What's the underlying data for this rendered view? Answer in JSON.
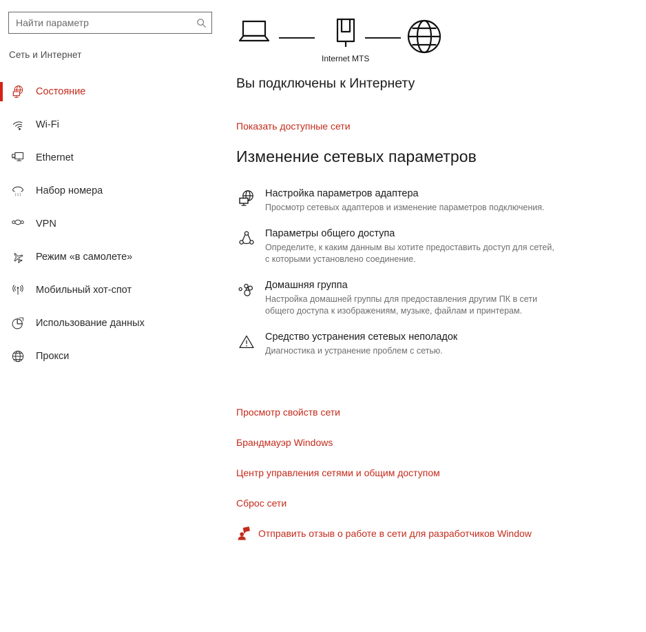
{
  "colors": {
    "accent": "#c42b1c",
    "accent_bar": "#d32216",
    "text_primary": "#1b1b1b",
    "text_secondary": "#6e6e6e",
    "background": "#ffffff"
  },
  "sidebar": {
    "search": {
      "placeholder": "Найти параметр",
      "value": "",
      "icon": "search-icon"
    },
    "category_title": "Сеть и Интернет",
    "items": [
      {
        "label": "Состояние",
        "icon": "network-status-icon",
        "selected": true
      },
      {
        "label": "Wi-Fi",
        "icon": "wifi-icon",
        "selected": false
      },
      {
        "label": "Ethernet",
        "icon": "ethernet-icon",
        "selected": false
      },
      {
        "label": "Набор номера",
        "icon": "dialup-icon",
        "selected": false
      },
      {
        "label": "VPN",
        "icon": "vpn-icon",
        "selected": false
      },
      {
        "label": "Режим «в самолете»",
        "icon": "airplane-icon",
        "selected": false
      },
      {
        "label": "Мобильный хот-спот",
        "icon": "hotspot-icon",
        "selected": false
      },
      {
        "label": "Использование данных",
        "icon": "data-usage-icon",
        "selected": false
      },
      {
        "label": "Прокси",
        "icon": "globe-icon",
        "selected": false
      }
    ]
  },
  "main": {
    "topology": {
      "nodes": [
        {
          "icon": "laptop-icon",
          "caption": ""
        },
        {
          "icon": "modem-icon",
          "caption": "Internet MTS"
        },
        {
          "icon": "globe-icon",
          "caption": ""
        }
      ]
    },
    "connection_status": "Вы подключены к Интернету",
    "show_networks_link": "Показать доступные сети",
    "section_heading": "Изменение сетевых параметров",
    "options": [
      {
        "icon": "adapter-settings-icon",
        "title": "Настройка параметров адаптера",
        "desc": "Просмотр сетевых адаптеров и изменение параметров подключения."
      },
      {
        "icon": "sharing-icon",
        "title": "Параметры общего доступа",
        "desc": "Определите, к каким данным вы хотите предоставить доступ для сетей, с которыми установлено соединение."
      },
      {
        "icon": "homegroup-icon",
        "title": "Домашняя группа",
        "desc": "Настройка домашней группы для предоставления другим ПК в сети общего доступа к изображениям, музыке, файлам и принтерам."
      },
      {
        "icon": "troubleshoot-warning-icon",
        "title": "Средство устранения сетевых неполадок",
        "desc": "Диагностика и устранение проблем с сетью."
      }
    ],
    "links": [
      {
        "label": "Просмотр свойств сети"
      },
      {
        "label": "Брандмауэр Windows"
      },
      {
        "label": "Центр управления сетями и общим доступом"
      },
      {
        "label": "Сброс сети"
      }
    ],
    "feedback": {
      "icon": "feedback-person-icon",
      "label": "Отправить отзыв о работе в сети для разработчиков Window"
    }
  }
}
